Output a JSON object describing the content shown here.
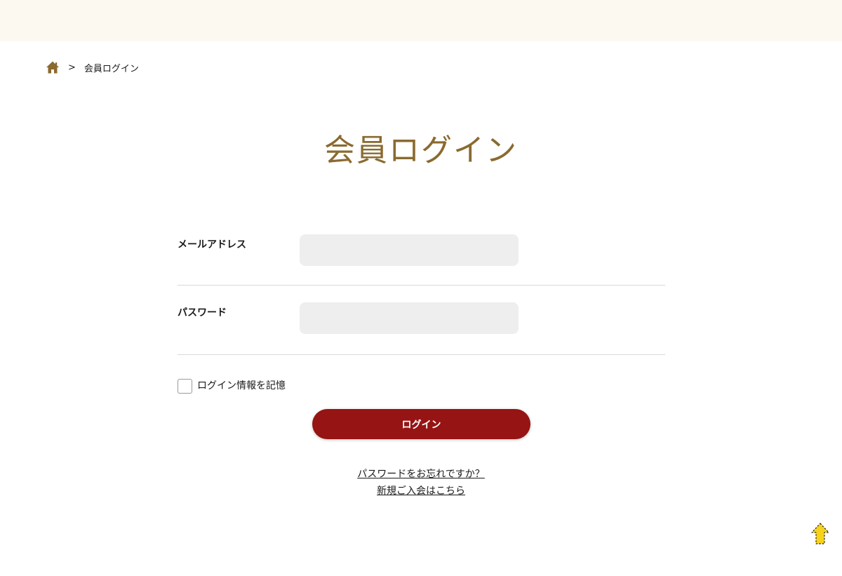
{
  "breadcrumb": {
    "home_icon": "home-icon",
    "separator": ">",
    "current": "会員ログイン"
  },
  "page": {
    "title": "会員ログイン"
  },
  "form": {
    "email_label": "メールアドレス",
    "email_value": "",
    "password_label": "パスワード",
    "password_value": "",
    "remember_label": "ログイン情報を記憶",
    "remember_checked": false,
    "submit_label": "ログイン"
  },
  "links": {
    "forgot_password": "パスワードをお忘れですか？",
    "register": "新規ご入会はこちら"
  },
  "colors": {
    "accent_gold": "#8a6a2f",
    "button_red": "#961414",
    "top_band": "#fcf9f1",
    "input_bg": "#eeeeee",
    "scroll_top_yellow": "#f7d21a"
  },
  "icons": {
    "scroll_top": "arrow-up-icon"
  }
}
